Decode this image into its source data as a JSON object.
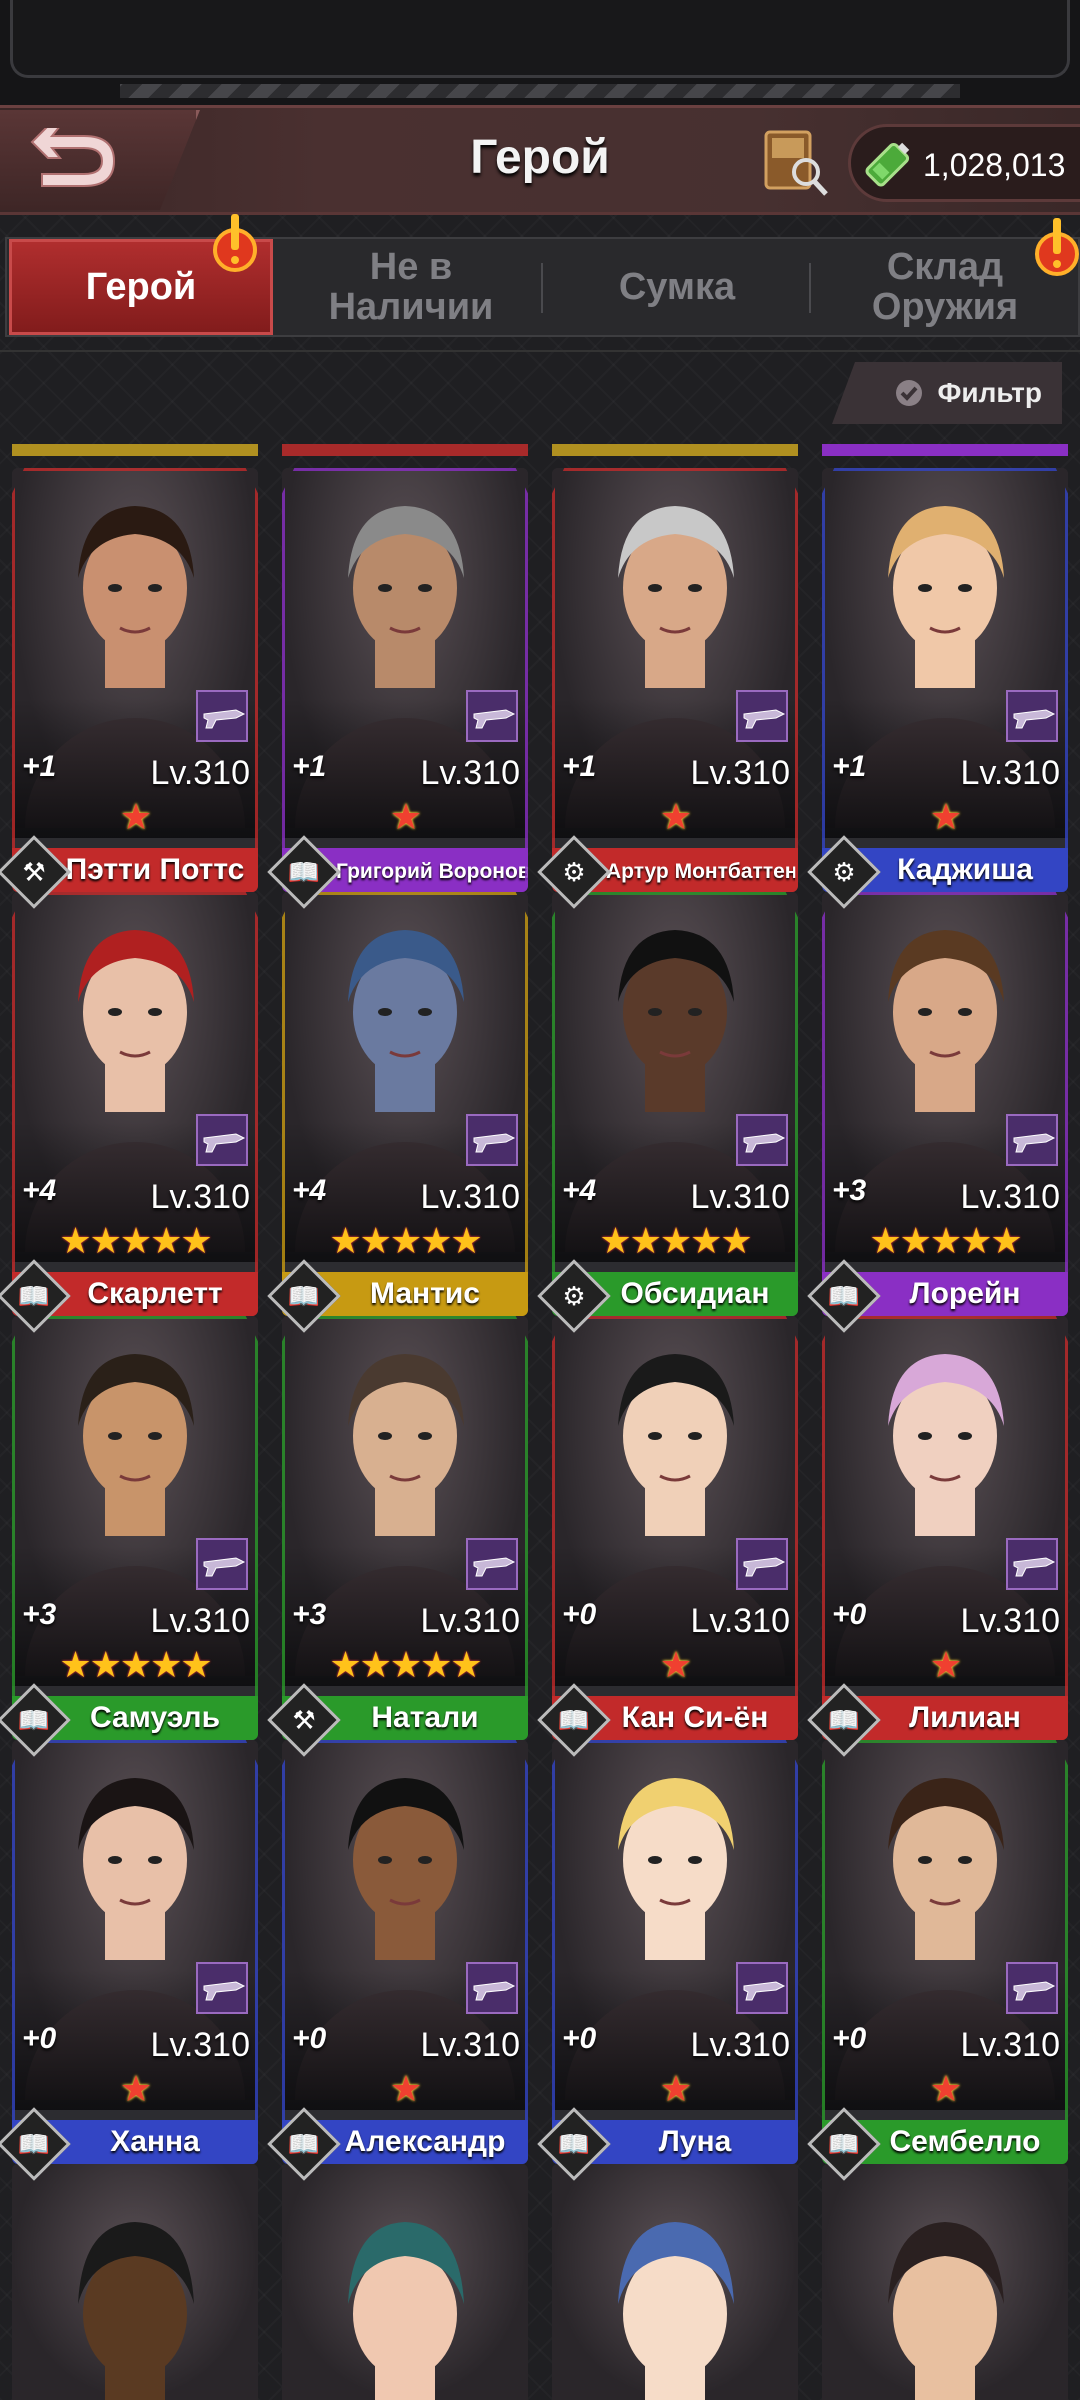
{
  "header": {
    "title": "Герой",
    "currency_value": "1,028,013"
  },
  "tabs": [
    {
      "label": "Герой",
      "active": true,
      "alert": true
    },
    {
      "label": "Не в Наличии",
      "active": false,
      "alert": false
    },
    {
      "label": "Сумка",
      "active": false,
      "alert": false
    },
    {
      "label": "Склад Оружия",
      "active": false,
      "alert": true
    }
  ],
  "filter": {
    "label": "Фильтр"
  },
  "colors": {
    "red": "#c22a2a",
    "purple": "#8a2fc4",
    "yellow": "#c79a12",
    "blue": "#3345c4",
    "green": "#2a9a2a"
  },
  "heroes": [
    {
      "name": "Пэтти Поттс",
      "level": "Lv.310",
      "plus": "+1",
      "stars": 1,
      "rarity": "red",
      "class_icon": "axe-icon"
    },
    {
      "name": "Григорий Воронов",
      "level": "Lv.310",
      "plus": "+1",
      "stars": 1,
      "rarity": "purple",
      "class_icon": "book-icon"
    },
    {
      "name": "Артур Монтбаттен",
      "level": "Lv.310",
      "plus": "+1",
      "stars": 1,
      "rarity": "red",
      "class_icon": "bike-icon"
    },
    {
      "name": "Каджиша",
      "level": "Lv.310",
      "plus": "+1",
      "stars": 1,
      "rarity": "blue",
      "class_icon": "bike-icon"
    },
    {
      "name": "Скарлетт",
      "level": "Lv.310",
      "plus": "+4",
      "stars": 5,
      "rarity": "red",
      "class_icon": "book-icon"
    },
    {
      "name": "Мантис",
      "level": "Lv.310",
      "plus": "+4",
      "stars": 5,
      "rarity": "yellow",
      "class_icon": "book-icon"
    },
    {
      "name": "Обсидиан",
      "level": "Lv.310",
      "plus": "+4",
      "stars": 5,
      "rarity": "green",
      "class_icon": "bike-icon"
    },
    {
      "name": "Лорейн",
      "level": "Lv.310",
      "plus": "+3",
      "stars": 5,
      "rarity": "purple",
      "class_icon": "book-icon"
    },
    {
      "name": "Самуэль",
      "level": "Lv.310",
      "plus": "+3",
      "stars": 5,
      "rarity": "green",
      "class_icon": "book-icon"
    },
    {
      "name": "Натали",
      "level": "Lv.310",
      "plus": "+3",
      "stars": 5,
      "rarity": "green",
      "class_icon": "axe-icon"
    },
    {
      "name": "Кан Си-ён",
      "level": "Lv.310",
      "plus": "+0",
      "stars": 1,
      "rarity": "red",
      "class_icon": "book-icon"
    },
    {
      "name": "Лилиан",
      "level": "Lv.310",
      "plus": "+0",
      "stars": 1,
      "rarity": "red",
      "class_icon": "book-icon"
    },
    {
      "name": "Ханна",
      "level": "Lv.310",
      "plus": "+0",
      "stars": 1,
      "rarity": "blue",
      "class_icon": "book-icon"
    },
    {
      "name": "Александр",
      "level": "Lv.310",
      "plus": "+0",
      "stars": 1,
      "rarity": "blue",
      "class_icon": "book-icon"
    },
    {
      "name": "Луна",
      "level": "Lv.310",
      "plus": "+0",
      "stars": 1,
      "rarity": "blue",
      "class_icon": "book-icon"
    },
    {
      "name": "Сембелло",
      "level": "Lv.310",
      "plus": "+0",
      "stars": 1,
      "rarity": "green",
      "class_icon": "book-icon"
    }
  ]
}
